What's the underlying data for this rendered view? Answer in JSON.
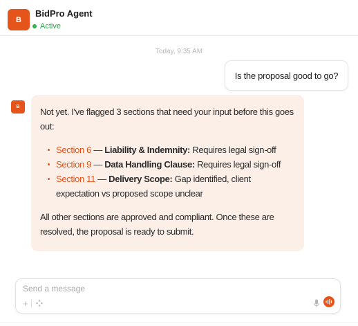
{
  "header": {
    "avatar_initial": "B",
    "agent_name": "BidPro Agent",
    "status": "Active"
  },
  "conversation": {
    "timestamp": "Today, 9:35 AM",
    "user_message": "Is the proposal good to go?",
    "bot_avatar_initial": "B",
    "bot_reply": {
      "intro": "Not yet. I've flagged 3 sections that need your input before this goes out:",
      "flags": [
        {
          "section": "Section 6",
          "sep": " — ",
          "title": "Liability & Indemnity:",
          "detail": " Requires legal sign-off"
        },
        {
          "section": "Section 9",
          "sep": " — ",
          "title": "Data Handling Clause:",
          "detail": " Requires legal sign-off"
        },
        {
          "section": "Section 11",
          "sep": " — ",
          "title": "Delivery Scope:",
          "detail": " Gap identified, client expectation vs proposed scope unclear"
        }
      ],
      "outro": "All other sections are approved and compliant. Once these are resolved, the proposal is ready to submit."
    }
  },
  "composer": {
    "placeholder": "Send a message",
    "value": "",
    "plus_glyph": "+"
  },
  "colors": {
    "accent": "#e4541b",
    "status_green": "#2fb14c",
    "bot_bubble_bg": "#fcefe7"
  },
  "icons": {
    "plus": "plus-icon",
    "tools": "tools-icon",
    "mic": "mic-icon",
    "voice": "waveform-icon"
  }
}
